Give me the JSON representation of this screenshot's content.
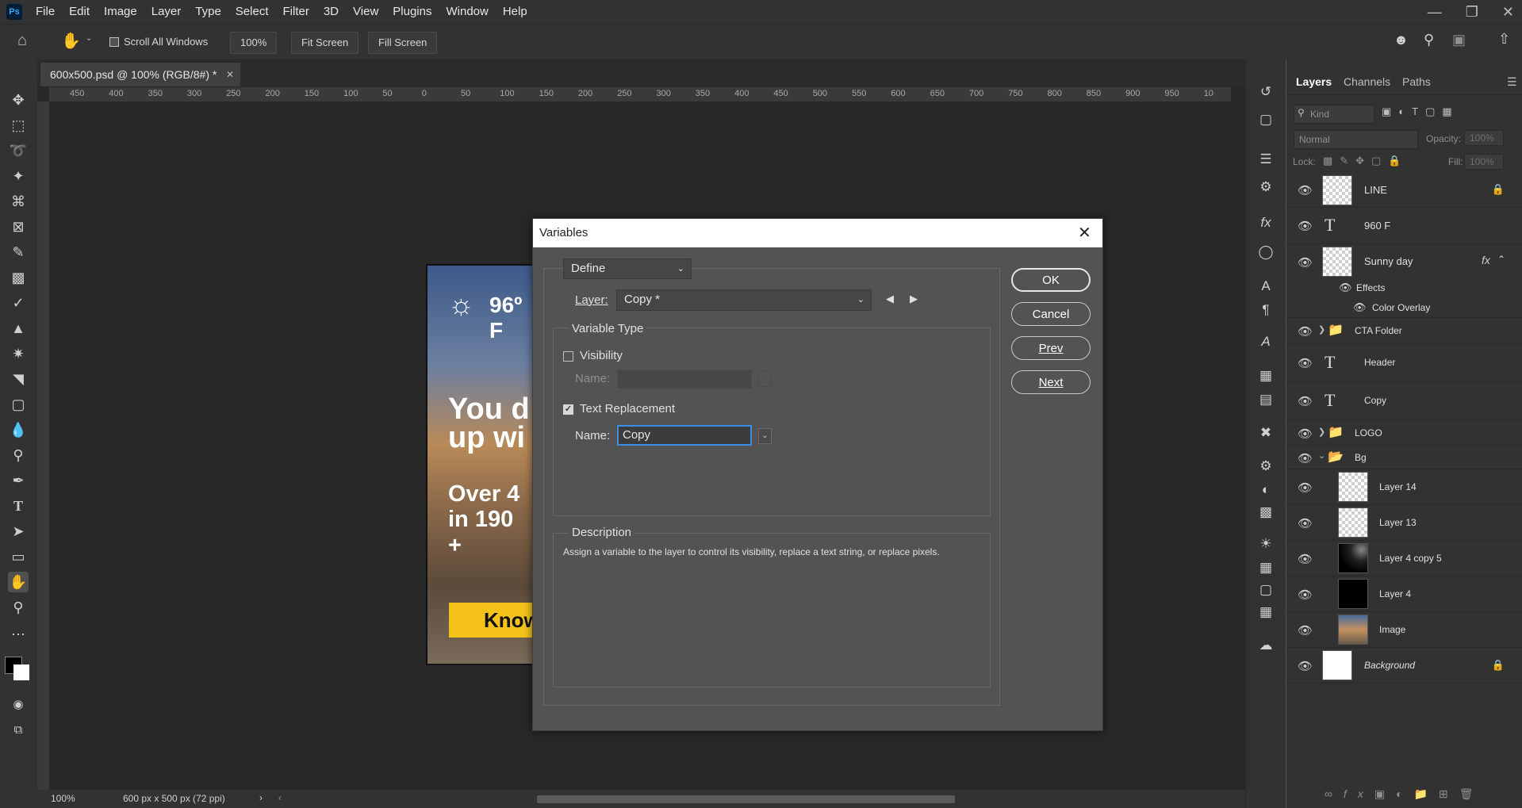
{
  "menubar": {
    "logo": "Ps",
    "items": [
      "File",
      "Edit",
      "Image",
      "Layer",
      "Type",
      "Select",
      "Filter",
      "3D",
      "View",
      "Plugins",
      "Window",
      "Help"
    ]
  },
  "options": {
    "scroll_all_windows": "Scroll All Windows",
    "zoom_value": "100%",
    "fit_screen": "Fit Screen",
    "fill_screen": "Fill Screen"
  },
  "document": {
    "tab_title": "600x500.psd @ 100% (RGB/8#) *",
    "ruler_h_ticks": [
      "450",
      "400",
      "350",
      "300",
      "250",
      "200",
      "150",
      "100",
      "50",
      "0",
      "50",
      "100",
      "150",
      "200",
      "250",
      "300",
      "350",
      "400",
      "450",
      "500",
      "550",
      "600",
      "650",
      "700",
      "750",
      "800",
      "850",
      "900",
      "950",
      "10"
    ],
    "zoom": "100%",
    "doc_info": "600 px x 500 px (72 ppi)"
  },
  "artwork": {
    "temp": "96º F",
    "headline1": "You d",
    "headline2": "up wi",
    "sub1": "Over 4",
    "sub2": "in 190 +",
    "cta": "Know"
  },
  "layers_panel": {
    "tabs": [
      "Layers",
      "Channels",
      "Paths"
    ],
    "filter_placeholder": "Kind",
    "blend_mode": "Normal",
    "opacity_label": "Opacity:",
    "opacity_value": "100%",
    "lock_label": "Lock:",
    "fill_label": "Fill:",
    "fill_value": "100%",
    "layers": [
      {
        "name": "LINE",
        "type": "pixel",
        "locked": true
      },
      {
        "name": "960 F",
        "type": "text"
      },
      {
        "name": "Sunny day",
        "type": "smart",
        "fx": "fx"
      },
      {
        "name": "Effects",
        "type": "effects"
      },
      {
        "name": "Color Overlay",
        "type": "effect"
      },
      {
        "name": "CTA Folder",
        "type": "group"
      },
      {
        "name": "Header",
        "type": "text"
      },
      {
        "name": "Copy",
        "type": "text"
      },
      {
        "name": "LOGO",
        "type": "group"
      },
      {
        "name": "Bg",
        "type": "group-open"
      },
      {
        "name": "Layer 14",
        "type": "pixel"
      },
      {
        "name": "Layer 13",
        "type": "pixel"
      },
      {
        "name": "Layer 4 copy 5",
        "type": "pixel"
      },
      {
        "name": "Layer 4",
        "type": "pixel"
      },
      {
        "name": "Image",
        "type": "pixel"
      },
      {
        "name": "Background",
        "type": "background",
        "locked": true
      }
    ]
  },
  "dialog": {
    "title": "Variables",
    "mode": "Define",
    "layer_label": "Layer:",
    "layer_value": "Copy *",
    "variable_type_legend": "Variable Type",
    "visibility_label": "Visibility",
    "visibility_checked": false,
    "visibility_name_label": "Name:",
    "text_replacement_label": "Text Replacement",
    "text_replacement_checked": true,
    "text_name_label": "Name:",
    "text_name_value": "Copy",
    "description_legend": "Description",
    "description_text": "Assign a variable to the layer to control its visibility, replace a text string, or replace pixels.",
    "buttons": {
      "ok": "OK",
      "cancel": "Cancel",
      "prev": "Prev",
      "next": "Next"
    }
  }
}
